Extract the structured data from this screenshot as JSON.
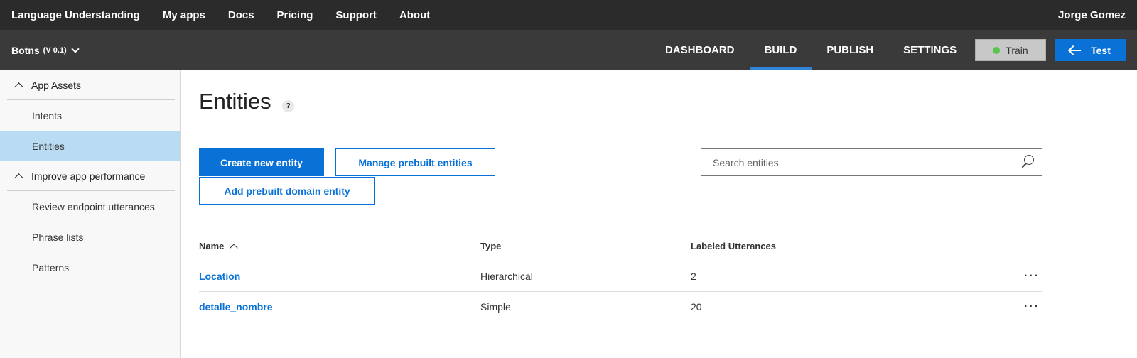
{
  "topbar": {
    "brand": "Language Understanding",
    "links": [
      "My apps",
      "Docs",
      "Pricing",
      "Support",
      "About"
    ],
    "user": "Jorge Gomez"
  },
  "appbar": {
    "app_name": "Botns",
    "version": "(V 0.1)",
    "tabs": [
      "DASHBOARD",
      "BUILD",
      "PUBLISH",
      "SETTINGS"
    ],
    "active_tab": "BUILD",
    "train_label": "Train",
    "test_label": "Test",
    "train_status_color": "#58c44a"
  },
  "sidebar": {
    "sections": [
      {
        "label": "App Assets",
        "items": [
          "Intents",
          "Entities"
        ]
      },
      {
        "label": "Improve app performance",
        "items": [
          "Review endpoint utterances",
          "Phrase lists",
          "Patterns"
        ]
      }
    ],
    "active_item": "Entities"
  },
  "main": {
    "title": "Entities",
    "help": "?",
    "create_label": "Create new entity",
    "manage_label": "Manage prebuilt entities",
    "domain_label": "Add prebuilt domain entity",
    "search_placeholder": "Search entities",
    "table": {
      "headers": [
        "Name",
        "Type",
        "Labeled Utterances"
      ],
      "rows": [
        {
          "name": "Location",
          "type": "Hierarchical",
          "utterances": "2",
          "more": "···"
        },
        {
          "name": "detalle_nombre",
          "type": "Simple",
          "utterances": "20",
          "more": "···"
        }
      ]
    }
  },
  "colors": {
    "accent": "#0a72d6",
    "active_tab_underline": "#2f86d8",
    "sidebar_active": "#b9dcf3"
  }
}
